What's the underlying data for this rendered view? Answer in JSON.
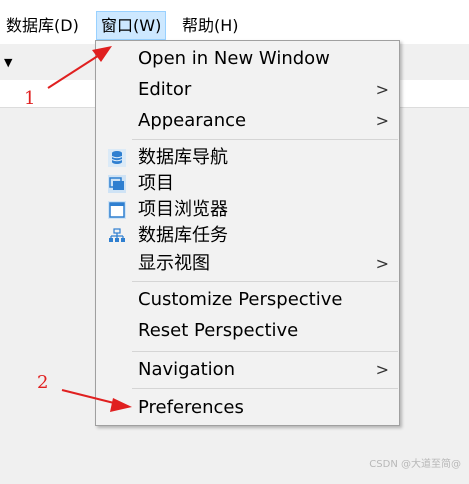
{
  "menubar": {
    "database": "数据库(D)",
    "window": "窗口(W)",
    "help": "帮助(H)"
  },
  "menu": {
    "items": [
      {
        "label": "Open in New Window"
      },
      {
        "label": "Editor",
        "submenu": true
      },
      {
        "label": "Appearance",
        "submenu": true
      },
      {
        "label": "数据库导航",
        "icon": "database-navigator-icon"
      },
      {
        "label": "项目",
        "icon": "projects-icon"
      },
      {
        "label": "项目浏览器",
        "icon": "project-explorer-icon"
      },
      {
        "label": "数据库任务",
        "icon": "database-tasks-icon"
      },
      {
        "label": "显示视图",
        "submenu": true
      },
      {
        "label": "Customize Perspective"
      },
      {
        "label": "Reset Perspective"
      },
      {
        "label": "Navigation",
        "submenu": true
      },
      {
        "label": "Preferences"
      }
    ],
    "submenu_glyph": ">"
  },
  "annotations": {
    "step1": "1",
    "step2": "2",
    "color": "#e02020"
  },
  "toolbar": {
    "caret": "▼"
  },
  "watermark": "CSDN @大道至简@"
}
